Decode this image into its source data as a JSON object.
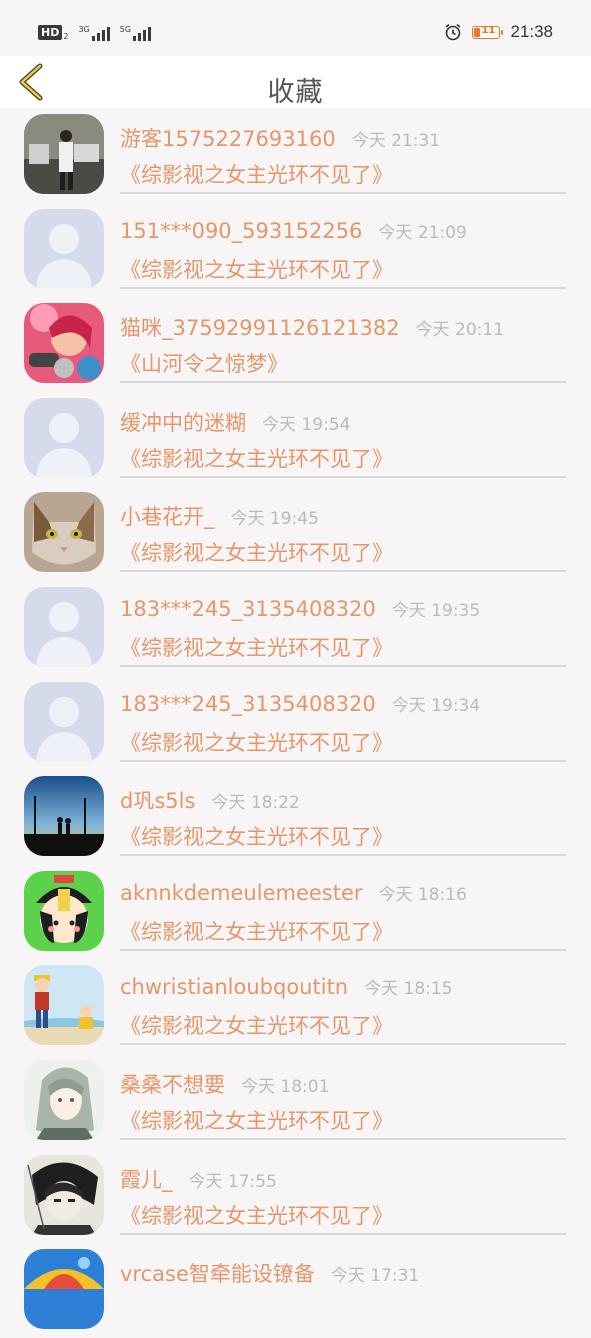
{
  "status_bar": {
    "hd": "HD",
    "sim1_sub": "2",
    "net1": "3G",
    "net2": "5G",
    "battery_level": "11",
    "time": "21:38"
  },
  "header": {
    "title": "收藏",
    "back_icon": "chevron-left-icon"
  },
  "items": [
    {
      "name": "游客1575227693160",
      "time": "今天 21:31",
      "book": "《综影视之女主光环不见了》",
      "avatar": "photo-room"
    },
    {
      "name": "151***090_593152256",
      "time": "今天 21:09",
      "book": "《综影视之女主光环不见了》",
      "avatar": "default"
    },
    {
      "name": "猫咪_37592991126121382",
      "time": "今天 20:11",
      "book": "《山河令之惊梦》",
      "avatar": "anime-pink"
    },
    {
      "name": "缓冲中的迷糊",
      "time": "今天 19:54",
      "book": "《综影视之女主光环不见了》",
      "avatar": "default"
    },
    {
      "name": "小巷花开_",
      "time": "今天 19:45",
      "book": "《综影视之女主光环不见了》",
      "avatar": "cat"
    },
    {
      "name": "183***245_3135408320",
      "time": "今天 19:35",
      "book": "《综影视之女主光环不见了》",
      "avatar": "default"
    },
    {
      "name": "183***245_3135408320",
      "time": "今天 19:34",
      "book": "《综影视之女主光环不见了》",
      "avatar": "default"
    },
    {
      "name": "d巩s5ls",
      "time": "今天 18:22",
      "book": "《综影视之女主光环不见了》",
      "avatar": "sunset"
    },
    {
      "name": "aknnkdemeulemeester",
      "time": "今天 18:16",
      "book": "《综影视之女主光环不见了》",
      "avatar": "cartoon-green"
    },
    {
      "name": "chwristianloubqoutitn",
      "time": "今天 18:15",
      "book": "《综影视之女主光环不见了》",
      "avatar": "kids-beach"
    },
    {
      "name": "桑桑不想要",
      "time": "今天 18:01",
      "book": "《综影视之女主光环不见了》",
      "avatar": "anime-grey"
    },
    {
      "name": "霞儿_",
      "time": "今天 17:55",
      "book": "《综影视之女主光环不见了》",
      "avatar": "sketch"
    },
    {
      "name": "vrcase智牵能设镣备",
      "time": "今天 17:31",
      "book": "",
      "avatar": "colorful"
    }
  ]
}
